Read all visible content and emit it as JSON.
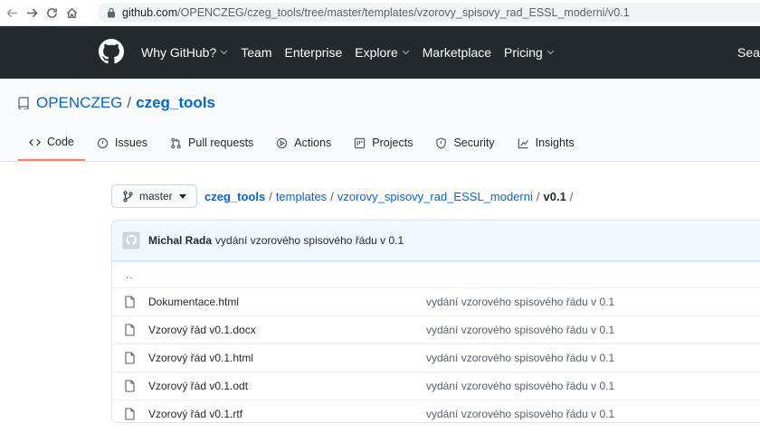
{
  "browser": {
    "url_host": "github.com",
    "url_path": "/OPENCZEG/czeg_tools/tree/master/templates/vzorovy_spisovy_rad_ESSL_moderni/v0.1"
  },
  "header": {
    "nav": [
      {
        "label": "Why GitHub?",
        "dropdown": true
      },
      {
        "label": "Team",
        "dropdown": false
      },
      {
        "label": "Enterprise",
        "dropdown": false
      },
      {
        "label": "Explore",
        "dropdown": true
      },
      {
        "label": "Marketplace",
        "dropdown": false
      },
      {
        "label": "Pricing",
        "dropdown": true
      }
    ],
    "search_cut": "Sear"
  },
  "repo": {
    "owner": "OPENCZEG",
    "separator": "/",
    "name": "czeg_tools"
  },
  "tabs": [
    {
      "label": "Code",
      "icon": "code-icon",
      "selected": true
    },
    {
      "label": "Issues",
      "icon": "issue-icon",
      "selected": false
    },
    {
      "label": "Pull requests",
      "icon": "pull-request-icon",
      "selected": false
    },
    {
      "label": "Actions",
      "icon": "play-icon",
      "selected": false
    },
    {
      "label": "Projects",
      "icon": "project-icon",
      "selected": false
    },
    {
      "label": "Security",
      "icon": "shield-icon",
      "selected": false
    },
    {
      "label": "Insights",
      "icon": "graph-icon",
      "selected": false
    }
  ],
  "branch": {
    "label": "master"
  },
  "breadcrumb": {
    "root": "czeg_tools",
    "parts": [
      "templates",
      "vzorovy_spisovy_rad_ESSL_moderni"
    ],
    "current": "v0.1",
    "sep": "/"
  },
  "commit": {
    "author": "Michal Rada",
    "message": "vydání vzorového spisového řádu v 0.1"
  },
  "files": {
    "up": "..",
    "items": [
      {
        "name": "Dokumentace.html",
        "message": "vydání vzorového spisového řádu v 0.1"
      },
      {
        "name": "Vzorový řád v0.1.docx",
        "message": "vydání vzorového spisového řádu v 0.1"
      },
      {
        "name": "Vzorový řád v0.1.html",
        "message": "vydání vzorového spisového řádu v 0.1"
      },
      {
        "name": "Vzorový řád v0.1.odt",
        "message": "vydání vzorového spisového řádu v 0.1"
      },
      {
        "name": "Vzorový řád v0.1.rtf",
        "message": "vydání vzorového spisového řádu v 0.1"
      }
    ]
  },
  "colors": {
    "header_bg": "#24292e",
    "link": "#0366d6",
    "tab_underline": "#f9826c",
    "commit_bar_bg": "#f1f8ff"
  }
}
